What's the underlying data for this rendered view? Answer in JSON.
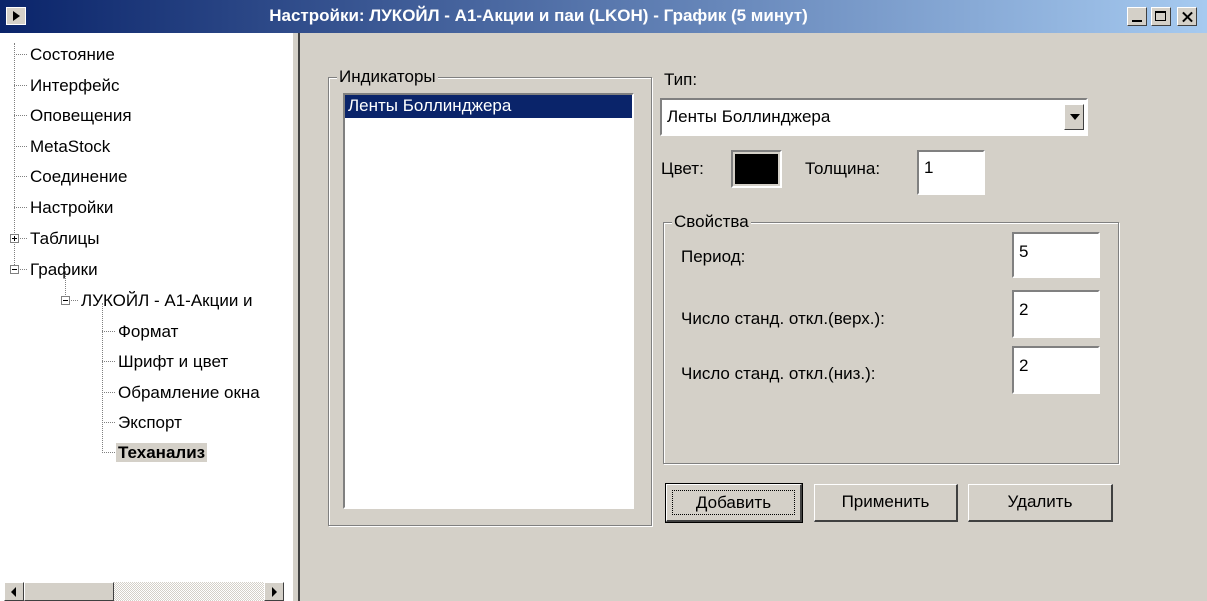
{
  "window": {
    "title": "Настройки: ЛУКОЙЛ - А1-Акции и паи (LKOH) - График (5 минут)"
  },
  "tree": {
    "items": [
      {
        "label": "Состояние"
      },
      {
        "label": "Интерфейс"
      },
      {
        "label": "Оповещения"
      },
      {
        "label": "MetaStock"
      },
      {
        "label": "Соединение"
      },
      {
        "label": "Настройки"
      },
      {
        "label": "Таблицы",
        "expander": "plus"
      },
      {
        "label": "Графики",
        "expander": "minus"
      },
      {
        "label": "ЛУКОЙЛ - А1-Акции и",
        "expander": "minus"
      },
      {
        "label": "Формат"
      },
      {
        "label": "Шрифт и цвет"
      },
      {
        "label": "Обрамление окна"
      },
      {
        "label": "Экспорт"
      },
      {
        "label": "Теханализ",
        "selected": true
      }
    ]
  },
  "indicators": {
    "legend": "Индикаторы",
    "items": [
      "Ленты Боллинджера"
    ]
  },
  "type": {
    "label": "Тип:",
    "selected": "Ленты Боллинджера"
  },
  "color": {
    "label": "Цвет:",
    "value": "#000000"
  },
  "thickness": {
    "label": "Толщина:",
    "value": "1"
  },
  "properties": {
    "legend": "Свойства",
    "period_label": "Период:",
    "period_value": "5",
    "upper_label": "Число станд. откл.(верх.):",
    "upper_value": "2",
    "lower_label": "Число станд. откл.(низ.):",
    "lower_value": "2"
  },
  "buttons": {
    "add": "Добавить",
    "apply": "Применить",
    "delete": "Удалить"
  }
}
